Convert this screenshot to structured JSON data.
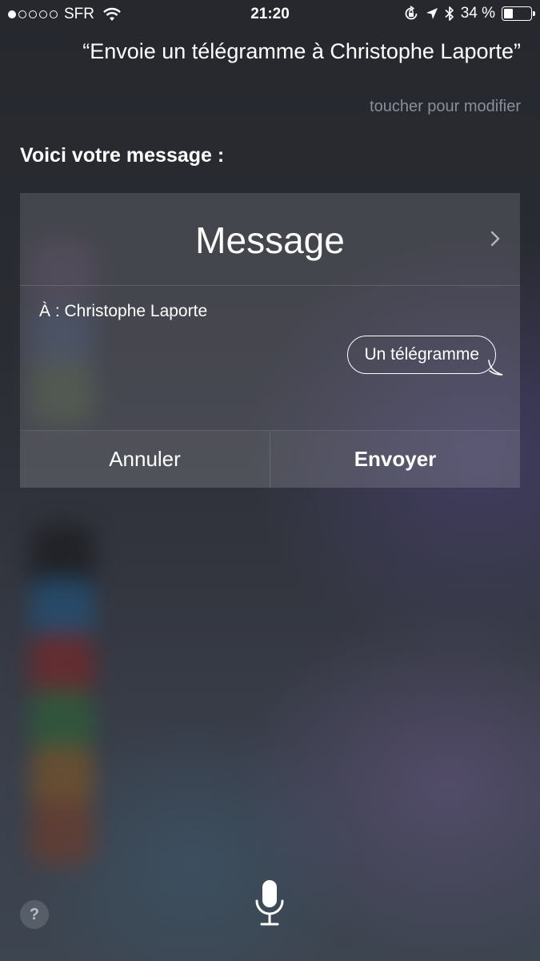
{
  "status_bar": {
    "carrier": "SFR",
    "signal_bars_filled": 1,
    "signal_bars_total": 5,
    "time": "21:20",
    "battery_percent": "34 %",
    "battery_level": 0.34,
    "icons": [
      "wifi-icon",
      "orientation-lock-icon",
      "location-arrow-icon",
      "bluetooth-icon",
      "battery-icon"
    ]
  },
  "siri": {
    "query": "“Envoie un télégramme à Christophe Laporte”",
    "edit_hint": "toucher pour modifier",
    "response_heading": "Voici votre message :"
  },
  "card": {
    "title": "Message",
    "recipient": "À : Christophe Laporte",
    "message_text": "Un télégramme",
    "cancel_label": "Annuler",
    "send_label": "Envoyer"
  },
  "footer": {
    "help_label": "?"
  },
  "colors": {
    "text": "#ffffff",
    "hint": "#8a8e99",
    "card_bg": "rgba(140,140,150,0.28)"
  }
}
